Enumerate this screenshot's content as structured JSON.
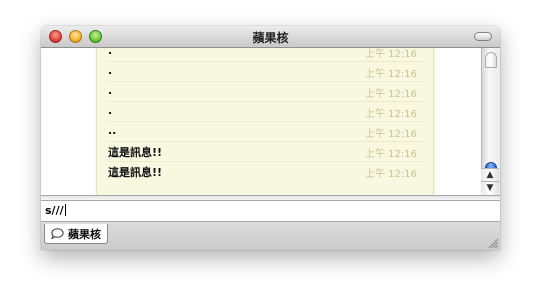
{
  "window": {
    "title": "蘋果核"
  },
  "messages": [
    {
      "text": ".",
      "time": "上午 12:16"
    },
    {
      "text": ".",
      "time": "上午 12:16"
    },
    {
      "text": ".",
      "time": "上午 12:16"
    },
    {
      "text": ".",
      "time": "上午 12:16"
    },
    {
      "text": "..",
      "time": "上午 12:16"
    },
    {
      "text": "這是訊息!!",
      "time": "上午 12:16"
    },
    {
      "text": "這是訊息!!",
      "time": "上午 12:16"
    }
  ],
  "input": {
    "value": "s///"
  },
  "tabs": [
    {
      "label": "蘋果核",
      "icon": "chat-bubble-icon"
    }
  ],
  "scrollbar": {
    "up_arrow": "▲",
    "down_arrow": "▼"
  },
  "colors": {
    "bubble_bg": "#f8f8e1",
    "timestamp": "#c9c48e",
    "scroll_thumb": "#2a5fc9"
  }
}
